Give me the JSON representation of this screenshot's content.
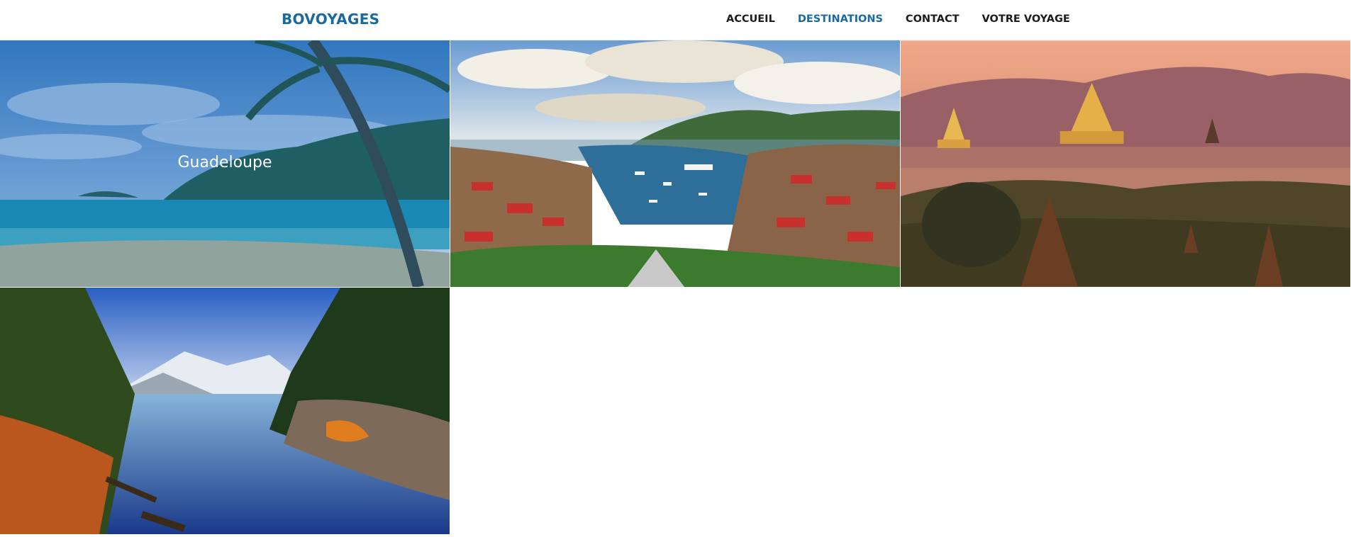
{
  "header": {
    "brand": "BOVOYAGES",
    "nav": [
      {
        "label": "ACCUEIL",
        "active": false
      },
      {
        "label": "DESTINATIONS",
        "active": true
      },
      {
        "label": "CONTACT",
        "active": false
      },
      {
        "label": "VOTRE VOYAGE",
        "active": false
      }
    ]
  },
  "destinations": [
    {
      "caption": "Guadeloupe",
      "image": "tropical-beach-palm-photo",
      "hovered": true
    },
    {
      "caption": "",
      "image": "harbor-town-photo",
      "hovered": false
    },
    {
      "caption": "",
      "image": "temples-misty-sunset-photo",
      "hovered": false
    },
    {
      "caption": "",
      "image": "mountain-lake-forest-photo",
      "hovered": false
    }
  ],
  "colors": {
    "accent": "#1a6aa0",
    "nav_text": "#1c1c1c",
    "overlay": "rgba(26,106,190,0.38)"
  }
}
